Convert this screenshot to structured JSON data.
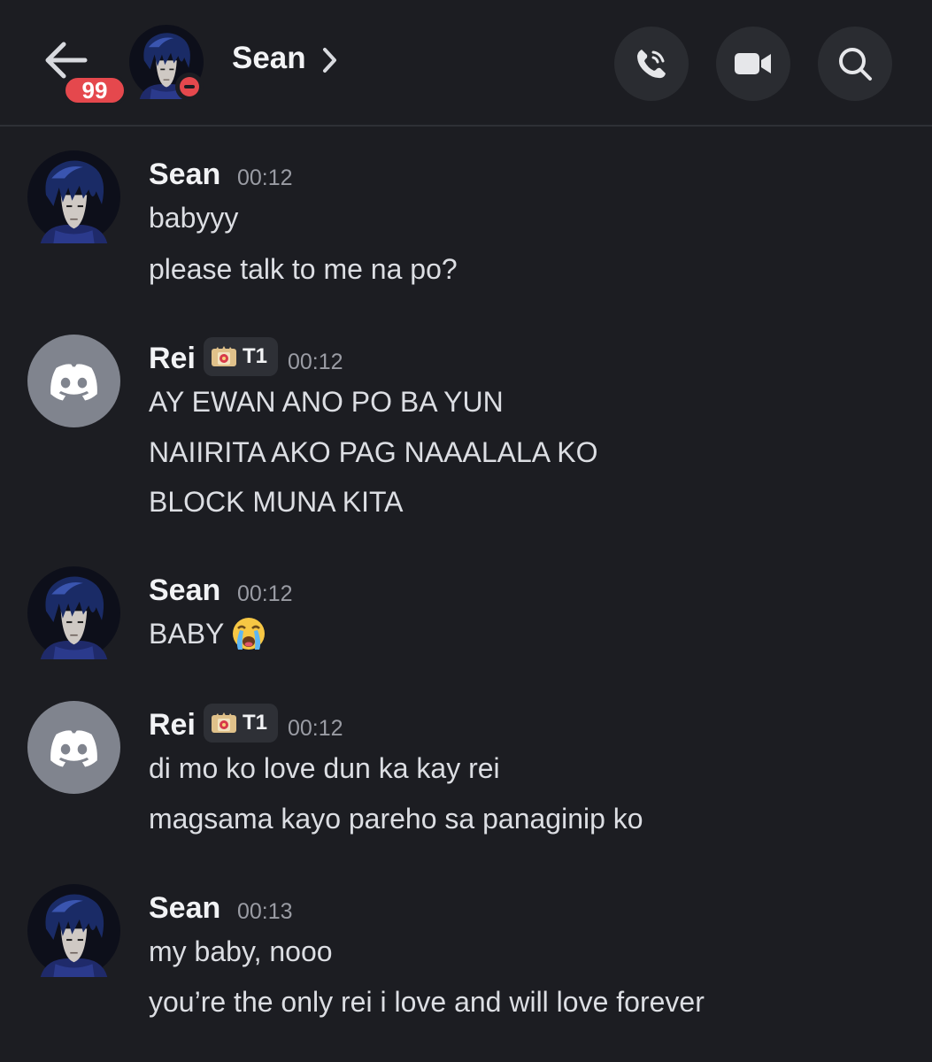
{
  "header": {
    "unread_count": "99",
    "title": "Sean",
    "status": "do-not-disturb",
    "back_icon": "arrow-left-icon",
    "chevron_icon": "chevron-right-icon",
    "call_icon": "phone-call-icon",
    "video_icon": "video-camera-icon",
    "search_icon": "search-icon"
  },
  "colors": {
    "background": "#1c1d22",
    "badge_red": "#e5484d",
    "button_bg": "#2a2c31",
    "discord_avatar_bg": "#80848e",
    "timestamp": "#9a9ca4"
  },
  "messages": [
    {
      "author": "Sean",
      "time": "00:12",
      "avatar": "anime-avatar",
      "lines": [
        "babyyy",
        "please talk to me na po?"
      ]
    },
    {
      "author": "Rei",
      "tag": "T1",
      "time": "00:12",
      "avatar": "discord-default-avatar",
      "lines": [
        "AY EWAN ANO PO BA YUN",
        "NAIIRITA AKO PAG NAAALALA KO",
        "BLOCK MUNA KITA"
      ]
    },
    {
      "author": "Sean",
      "time": "00:12",
      "avatar": "anime-avatar",
      "lines": [
        "BABY"
      ],
      "emoji": "loudly-crying-face-emoji"
    },
    {
      "author": "Rei",
      "tag": "T1",
      "time": "00:12",
      "avatar": "discord-default-avatar",
      "lines": [
        "di mo ko love dun ka kay rei",
        "magsama kayo pareho sa panaginip ko"
      ]
    },
    {
      "author": "Sean",
      "time": "00:13",
      "avatar": "anime-avatar",
      "lines": [
        "my baby, nooo",
        "you’re the only rei i love and will love forever"
      ]
    }
  ]
}
